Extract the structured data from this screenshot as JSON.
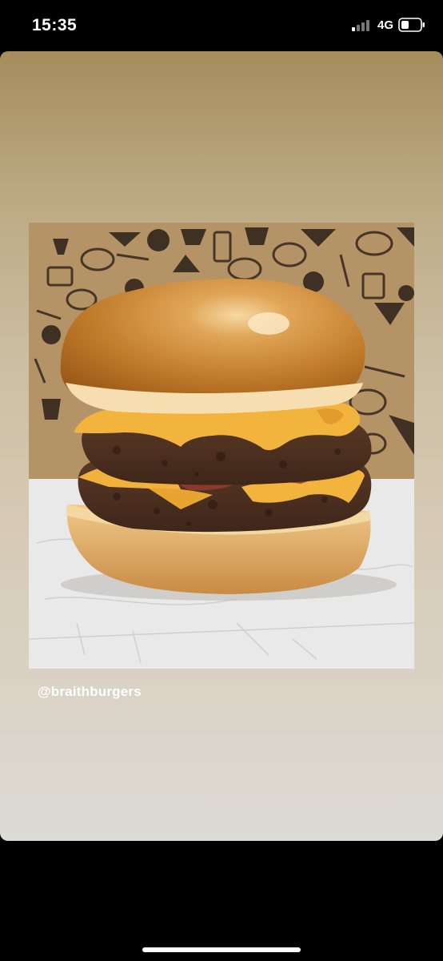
{
  "status_bar": {
    "time": "15:35",
    "network": "4G",
    "signal_icon": "signal-bars-icon",
    "battery_icon": "battery-icon"
  },
  "story": {
    "username": "@braithburgers",
    "photo_subject": "double-cheeseburger-photo"
  },
  "colors": {
    "card_top": "#a68c5c",
    "card_bottom": "#dddbd6",
    "status_bar_bg": "#000000"
  }
}
